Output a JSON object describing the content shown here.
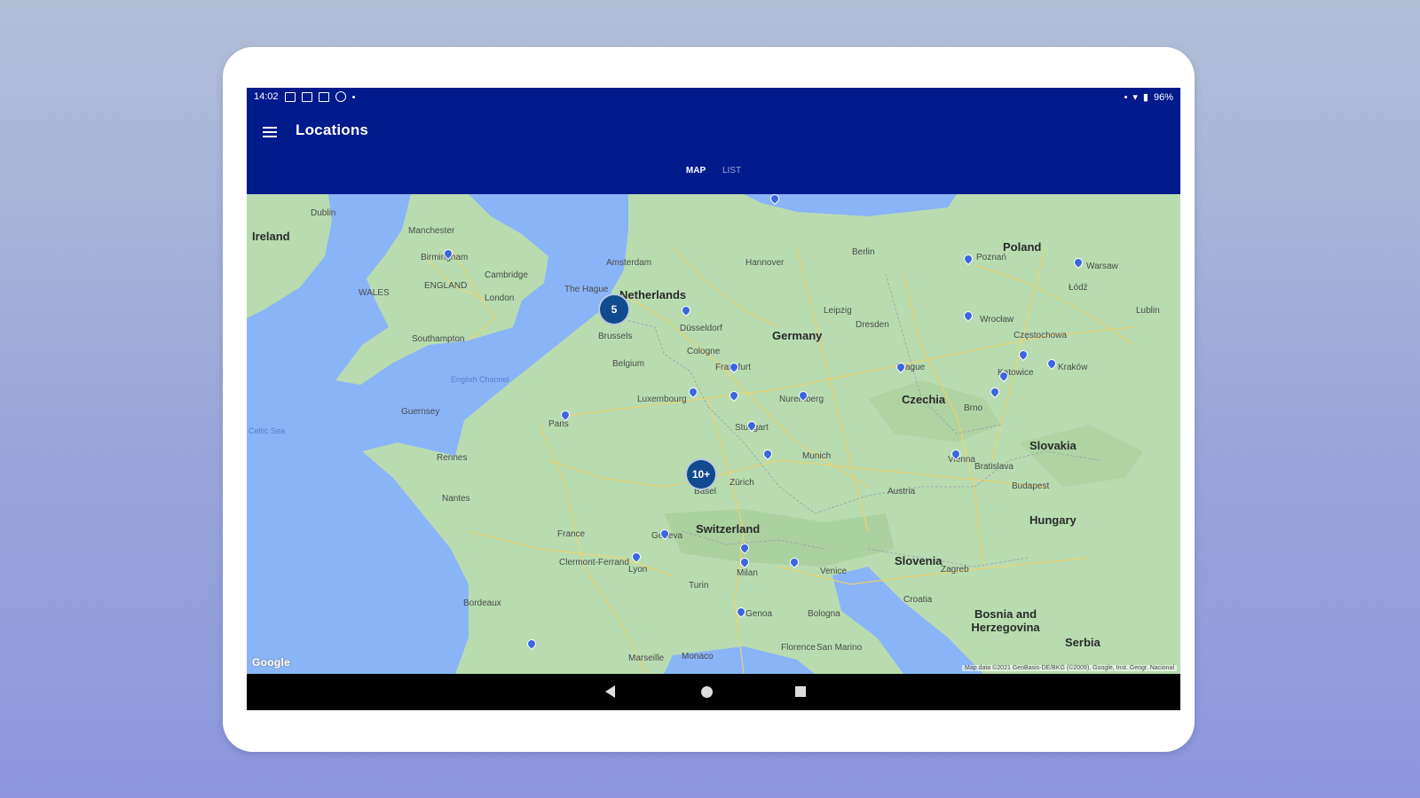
{
  "status": {
    "time": "14:02",
    "battery": "96%"
  },
  "toolbar": {
    "title": "Locations",
    "menu_icon": "hamburger-menu-icon"
  },
  "tabs": [
    {
      "label": "MAP",
      "active": true
    },
    {
      "label": "LIST",
      "active": false
    }
  ],
  "map": {
    "countries": [
      "Ireland",
      "Netherlands",
      "Belgium",
      "Luxembourg",
      "Germany",
      "Poland",
      "Czechia",
      "Slovakia",
      "Austria",
      "Hungary",
      "Switzerland",
      "France",
      "Slovenia",
      "Croatia",
      "Bosnia and Herzegovina",
      "Serbia",
      "San Marino",
      "Monaco"
    ],
    "cities": [
      "Dublin",
      "Manchester",
      "Birmingham",
      "Cambridge",
      "London",
      "Southampton",
      "Amsterdam",
      "The Hague",
      "Brussels",
      "Düsseldorf",
      "Cologne",
      "Frankfurt",
      "Hannover",
      "Berlin",
      "Leipzig",
      "Dresden",
      "Nuremberg",
      "Stuttgart",
      "Munich",
      "Prague",
      "Brno",
      "Wrocław",
      "Poznań",
      "Łódź",
      "Warsaw",
      "Kraków",
      "Katowice",
      "Częstochowa",
      "Lublin",
      "Vienna",
      "Bratislava",
      "Budapest",
      "Zagreb",
      "Venice",
      "Milan",
      "Turin",
      "Bologna",
      "Florence",
      "Genoa",
      "Lyon",
      "Paris",
      "Geneva",
      "Zürich",
      "Basel",
      "Marseille",
      "Nantes",
      "Rennes",
      "Bordeaux",
      "Clermont-Ferrand",
      "Guernsey",
      "WALES",
      "ENGLAND"
    ],
    "seas": [
      "Celtic Sea",
      "English Channel"
    ],
    "clusters": [
      {
        "label": "5"
      },
      {
        "label": "10+"
      }
    ],
    "google_logo": "Google",
    "attribution": "Map data ©2021 GeoBasis-DE/BKG (©2009), Google, Inst. Geogr. Nacional"
  },
  "colors": {
    "appbar": "#011a8c",
    "land": "#b8dcb0",
    "water": "#8ab4f8",
    "pin": "#3b66e0",
    "cluster": "#124a8f"
  }
}
